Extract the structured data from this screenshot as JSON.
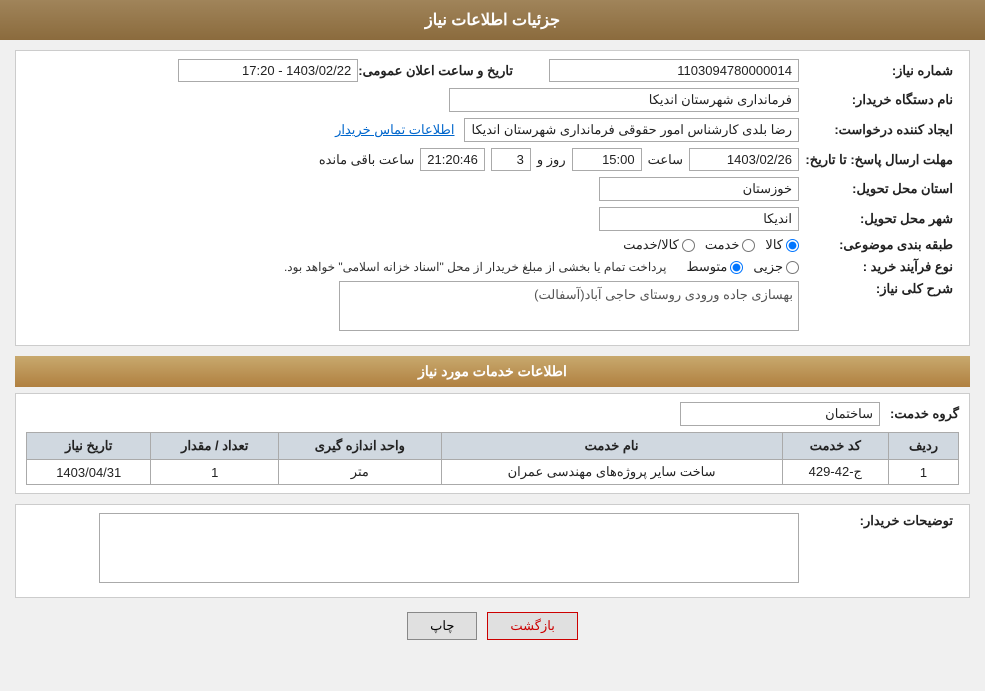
{
  "header": {
    "title": "جزئیات اطلاعات نیاز"
  },
  "fields": {
    "need_number_label": "شماره نیاز:",
    "need_number_value": "1103094780000014",
    "buyer_org_label": "نام دستگاه خریدار:",
    "buyer_org_value": "فرمانداری شهرستان اندیکا",
    "announce_date_label": "تاریخ و ساعت اعلان عمومی:",
    "announce_date_value": "1403/02/22 - 17:20",
    "creator_label": "ایجاد کننده درخواست:",
    "creator_value": "رضا بلدی کارشناس امور حقوقی فرمانداری شهرستان اندیکا",
    "buyer_contact_link": "اطلاعات تماس خریدار",
    "send_deadline_label": "مهلت ارسال پاسخ: تا تاریخ:",
    "send_date_value": "1403/02/26",
    "send_time_label": "ساعت",
    "send_time_value": "15:00",
    "send_days_label": "روز و",
    "send_days_value": "3",
    "send_remain_label": "ساعت باقی مانده",
    "send_remain_value": "21:20:46",
    "province_label": "استان محل تحویل:",
    "province_value": "خوزستان",
    "city_label": "شهر محل تحویل:",
    "city_value": "اندیکا",
    "category_label": "طبقه بندی موضوعی:",
    "category_options": [
      "کالا",
      "خدمت",
      "کالا/خدمت"
    ],
    "category_selected": "کالا",
    "purchase_type_label": "نوع فرآیند خرید :",
    "purchase_type_options": [
      "جزیی",
      "متوسط"
    ],
    "purchase_type_notice": "پرداخت تمام یا بخشی از مبلغ خریدار از محل \"اسناد خزانه اسلامی\" خواهد بود.",
    "description_label": "شرح کلی نیاز:",
    "description_value": "بهسازی جاده ورودی روستای حاجی آباد(آسفالت)"
  },
  "services_section": {
    "title": "اطلاعات خدمات مورد نیاز",
    "group_label": "گروه خدمت:",
    "group_value": "ساختمان",
    "table_headers": [
      "ردیف",
      "کد خدمت",
      "نام خدمت",
      "واحد اندازه گیری",
      "تعداد / مقدار",
      "تاریخ نیاز"
    ],
    "table_rows": [
      {
        "row": "1",
        "code": "ج-42-429",
        "name": "ساخت سایر پروژه‌های مهندسی عمران",
        "unit": "متر",
        "quantity": "1",
        "date": "1403/04/31"
      }
    ]
  },
  "buyer_description_label": "توضیحات خریدار:",
  "buyer_description_value": "",
  "buttons": {
    "print_label": "چاپ",
    "back_label": "بازگشت"
  }
}
